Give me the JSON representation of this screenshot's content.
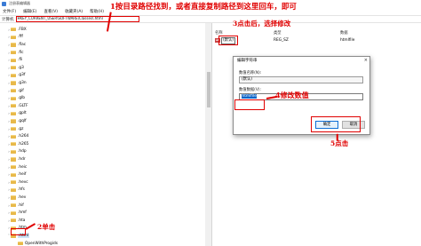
{
  "window": {
    "title": "注册表编辑器"
  },
  "menu": [
    "文件(F)",
    "编辑(E)",
    "查看(V)",
    "收藏夹(A)",
    "帮助(H)"
  ],
  "address": {
    "label": "计算机",
    "path": "HKEY_CURRENT_USER\\SOFTWARE\\Classes\\.html"
  },
  "tree": {
    "items": [
      ".FBX",
      ".fff",
      ".flac",
      ".flc",
      ".fli",
      ".g3",
      ".g3f",
      ".g3n",
      ".gif",
      ".glb",
      ".GLTF",
      ".gplt",
      ".gqlf",
      ".gz",
      ".h264",
      ".h265",
      ".hdp",
      ".hdr",
      ".heic",
      ".heif",
      ".hevc",
      ".hfs",
      ".hev",
      ".hif",
      ".hmf",
      ".hta",
      ".htm",
      ".html",
      "OpenWithProgids",
      ".hsi"
    ],
    "selected_index": 27
  },
  "values": {
    "columns": {
      "name": "名称",
      "type": "类型",
      "data": "数据"
    },
    "rows": [
      {
        "name": "(默认)",
        "type": "REG_SZ",
        "data": "htmlfile",
        "icon": "ab-icon"
      }
    ]
  },
  "dialog": {
    "title": "编辑字符串",
    "name_label": "数值名称(N):",
    "name_value": "(默认)",
    "data_label": "数值数据(V):",
    "data_value": "htmlfile",
    "ok_label": "确定",
    "cancel_label": "取消",
    "close_glyph": "×"
  },
  "annotations": {
    "step1": "1按目录路径找到，或者直接复制路径到这里回车，即可",
    "step2": "2单击",
    "step3": "3点击后，选择修改",
    "step4": "4修改数值",
    "step5": "5点击"
  },
  "colors": {
    "annotation_red": "#e00000",
    "selection_blue": "#0a64c8",
    "folder_yellow": "#e8b94a"
  }
}
